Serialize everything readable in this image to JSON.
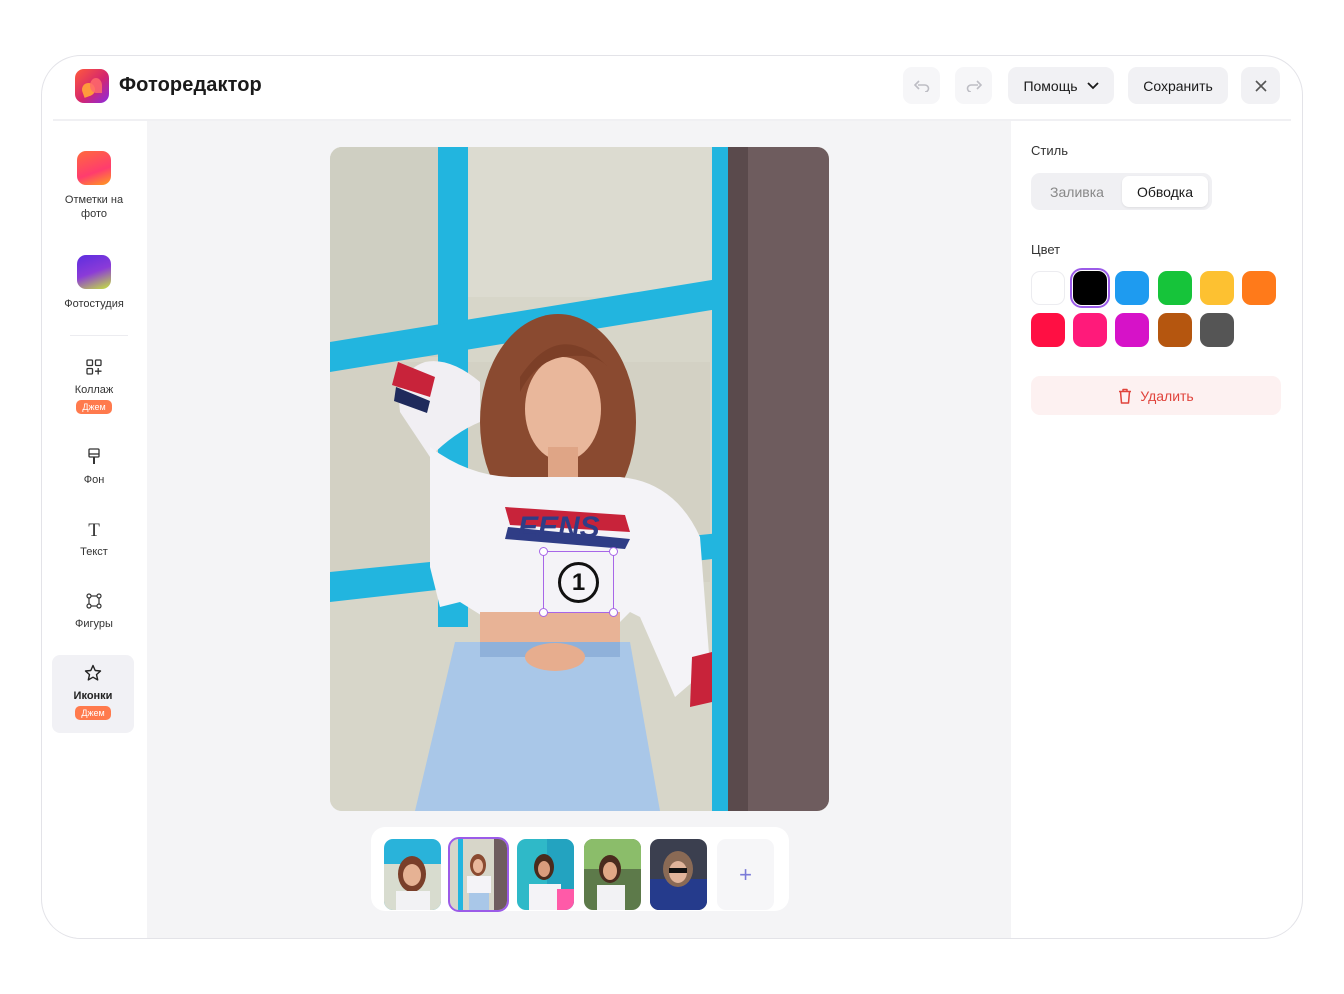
{
  "header": {
    "title": "Фоторедактор",
    "help_label": "Помощь",
    "save_label": "Сохранить",
    "undo_icon": "undo-icon",
    "redo_icon": "redo-icon",
    "close_icon": "close-icon"
  },
  "sidebar": {
    "items": [
      {
        "label": "Отметки на фото",
        "icon": "photo-marks-app-icon"
      },
      {
        "label": "Фотостудия",
        "icon": "photo-studio-app-icon"
      },
      {
        "label": "Коллаж",
        "icon": "collage-icon",
        "badge": "Джем"
      },
      {
        "label": "Фон",
        "icon": "brush-icon"
      },
      {
        "label": "Текст",
        "icon": "text-icon"
      },
      {
        "label": "Фигуры",
        "icon": "shapes-icon"
      },
      {
        "label": "Иконки",
        "icon": "star-icon",
        "badge": "Джем",
        "active": true
      }
    ]
  },
  "canvas": {
    "photo_text": "EENS",
    "sticker_number": "1"
  },
  "thumbnails": {
    "count": 5,
    "selected_index": 1,
    "add_label": "+"
  },
  "panel": {
    "style_label": "Стиль",
    "style_options": [
      "Заливка",
      "Обводка"
    ],
    "style_selected": "Обводка",
    "color_label": "Цвет",
    "colors": [
      "#ffffff",
      "#000000",
      "#1e9bf0",
      "#16c43a",
      "#fdc131",
      "#ff7a1a",
      "#ff0f43",
      "#ff1a7a",
      "#d612c8",
      "#b5560f",
      "#555555"
    ],
    "selected_color": "#000000",
    "delete_label": "Удалить"
  }
}
